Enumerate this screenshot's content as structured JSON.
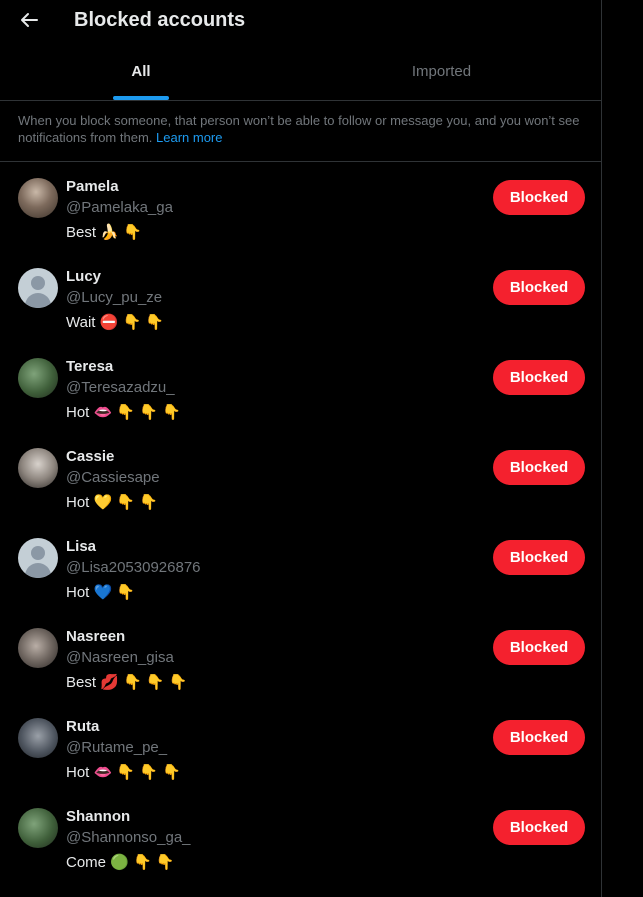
{
  "header": {
    "title": "Blocked accounts"
  },
  "tabs": [
    {
      "label": "All"
    },
    {
      "label": "Imported"
    }
  ],
  "info": {
    "text": "When you block someone, that person won’t be able to follow or message you, and you won’t see notifications from them.",
    "link": "Learn more"
  },
  "accounts": [
    {
      "name": "Pamela",
      "handle": "@Pamelaka_ga",
      "bio": "Best 🍌 👇",
      "button": "Blocked",
      "avatar": "photo"
    },
    {
      "name": "Lucy",
      "handle": "@Lucy_pu_ze",
      "bio": "Wait ⛔ 👇 👇",
      "button": "Blocked",
      "avatar": "default"
    },
    {
      "name": "Teresa",
      "handle": "@Teresazadzu_",
      "bio": "Hot 👄 👇 👇 👇",
      "button": "Blocked",
      "avatar": "photo"
    },
    {
      "name": "Cassie",
      "handle": "@Cassiesape",
      "bio": "Hot 💛 👇 👇",
      "button": "Blocked",
      "avatar": "photo"
    },
    {
      "name": "Lisa",
      "handle": "@Lisa20530926876",
      "bio": "Hot 💙 👇",
      "button": "Blocked",
      "avatar": "default"
    },
    {
      "name": "Nasreen",
      "handle": "@Nasreen_gisa",
      "bio": "Best 💋 👇 👇 👇",
      "button": "Blocked",
      "avatar": "photo"
    },
    {
      "name": "Ruta",
      "handle": "@Rutame_pe_",
      "bio": "Hot 👄 👇 👇 👇",
      "button": "Blocked",
      "avatar": "photo"
    },
    {
      "name": "Shannon",
      "handle": "@Shannonso_ga_",
      "bio": "Come 🟢 👇 👇",
      "button": "Blocked",
      "avatar": "photo"
    }
  ],
  "colors": {
    "accent": "#1d9bf0",
    "blocked": "#f4212e",
    "background": "#000000",
    "muted": "#71767b"
  }
}
